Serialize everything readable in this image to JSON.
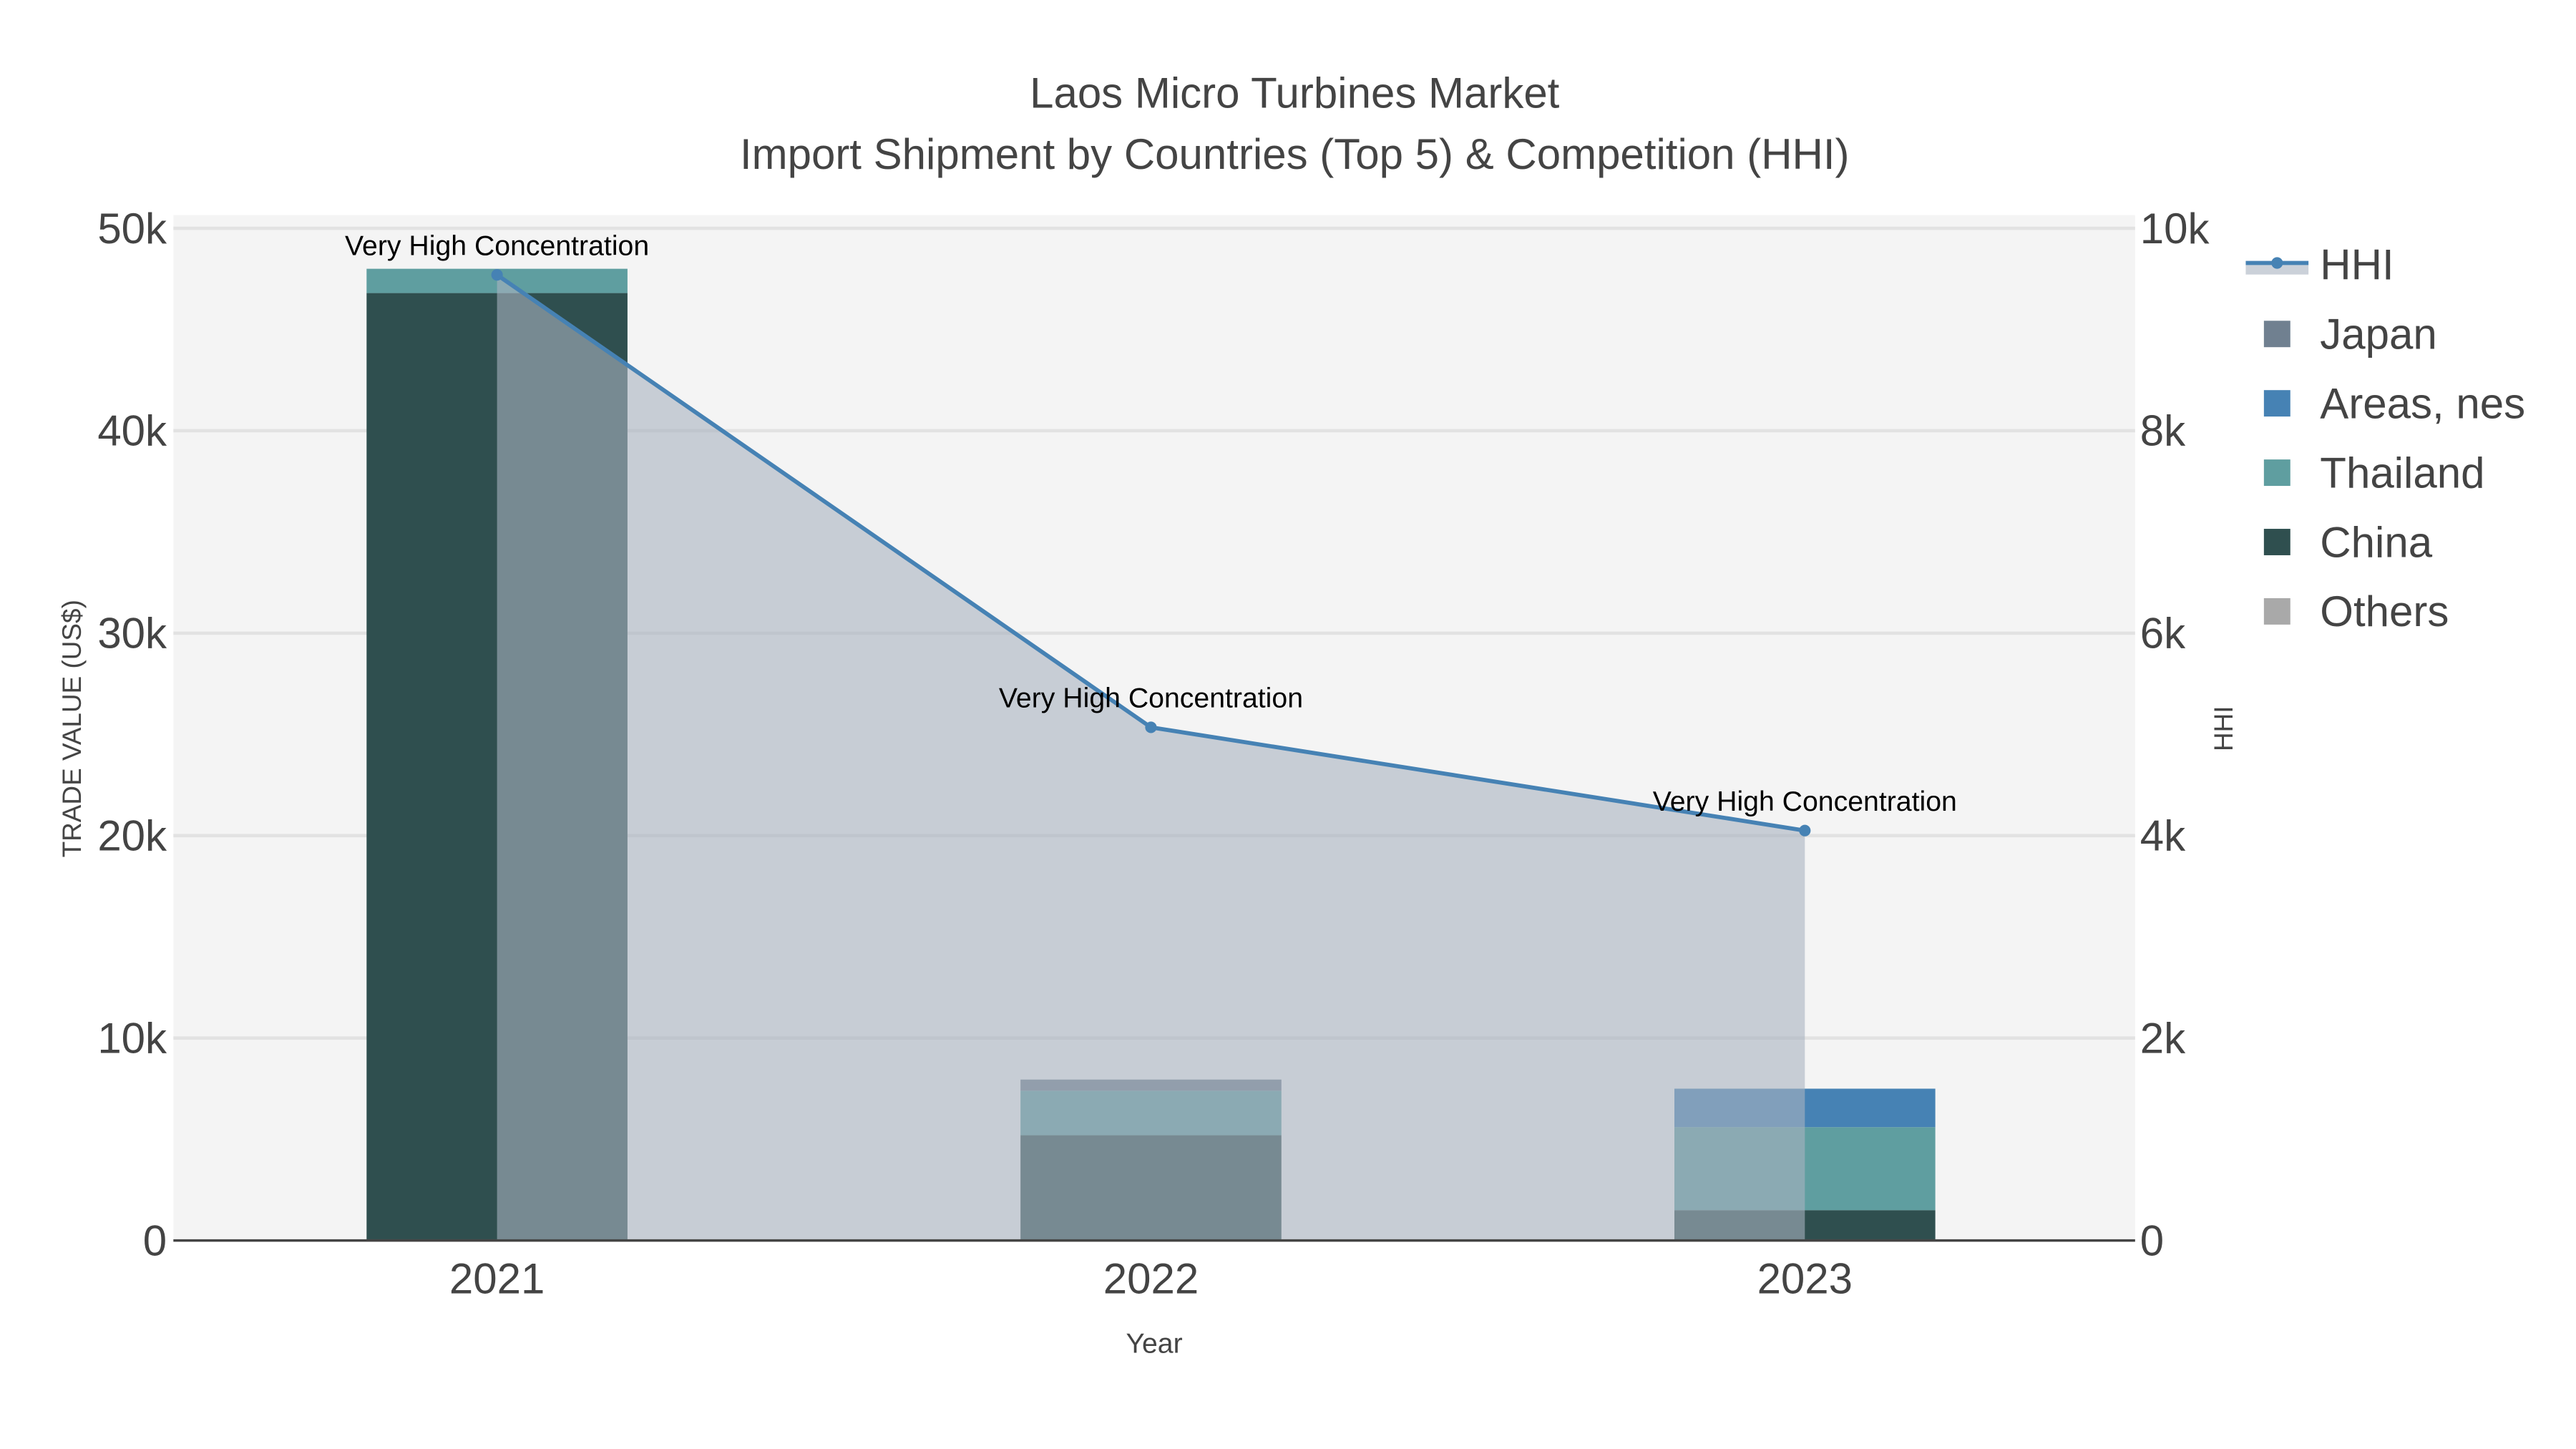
{
  "chart_data": {
    "type": "bar",
    "title": "Laos Micro Turbines Market",
    "subtitle": "Import Shipment by Countries (Top 5) & Competition (HHI)",
    "xlabel": "Year",
    "ylabel": "TRADE VALUE (US$)",
    "y2label": "HHI",
    "categories": [
      "2021",
      "2022",
      "2023"
    ],
    "ylim": [
      0,
      50000
    ],
    "y2lim": [
      0,
      10000
    ],
    "yticks": [
      {
        "v": 0,
        "label": "0"
      },
      {
        "v": 10000,
        "label": "10k"
      },
      {
        "v": 20000,
        "label": "20k"
      },
      {
        "v": 30000,
        "label": "30k"
      },
      {
        "v": 40000,
        "label": "40k"
      },
      {
        "v": 50000,
        "label": "50k"
      }
    ],
    "y2ticks": [
      {
        "v": 0,
        "label": "0"
      },
      {
        "v": 2000,
        "label": "2k"
      },
      {
        "v": 4000,
        "label": "4k"
      },
      {
        "v": 6000,
        "label": "6k"
      },
      {
        "v": 8000,
        "label": "8k"
      },
      {
        "v": 10000,
        "label": "10k"
      }
    ],
    "series": [
      {
        "name": "China",
        "color": "#2f4f4f",
        "values": [
          46800,
          5200,
          1500
        ]
      },
      {
        "name": "Thailand",
        "color": "#5f9ea0",
        "values": [
          1200,
          2200,
          4100
        ]
      },
      {
        "name": "Areas, nes",
        "color": "#4682b4",
        "values": [
          0,
          0,
          1900
        ]
      },
      {
        "name": "Japan",
        "color": "#708090",
        "values": [
          0,
          550,
          0
        ]
      },
      {
        "name": "Others",
        "color": "#a9a9a9",
        "values": [
          0,
          0,
          0
        ]
      }
    ],
    "hhi": {
      "name": "HHI",
      "color": "#4682b4",
      "values": [
        9540,
        5070,
        4050
      ],
      "labels": [
        "Very High Concentration",
        "Very High Concentration",
        "Very High Concentration"
      ]
    },
    "legend_order": [
      "HHI",
      "Japan",
      "Areas, nes",
      "Thailand",
      "China",
      "Others"
    ],
    "legend_position": "right",
    "grid": true
  }
}
